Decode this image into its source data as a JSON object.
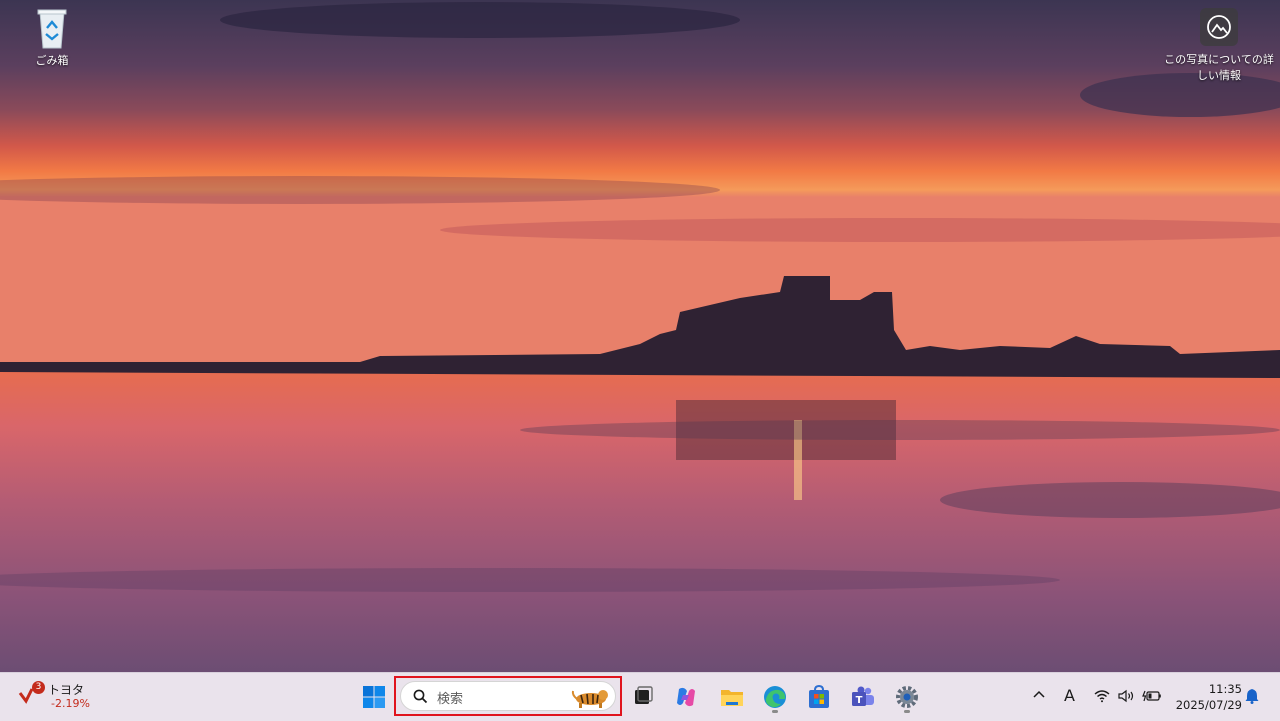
{
  "desktop": {
    "recycle_bin_label": "ごみ箱",
    "spotlight_label_line1": "この写真についての詳",
    "spotlight_label_line2": "しい情報"
  },
  "taskbar": {
    "widget": {
      "badge_count": "3",
      "name": "トヨタ",
      "change": "-2.19%",
      "change_color": "#c42b1c"
    },
    "search": {
      "placeholder": "検索",
      "highlight_color": "#e0141e"
    },
    "apps": [
      "start-icon",
      "task-view-icon",
      "copilot-icon",
      "file-explorer-icon",
      "edge-icon",
      "store-icon",
      "teams-icon",
      "settings-icon"
    ],
    "tray": {
      "ime": "A",
      "time": "11:35",
      "date": "2025/07/29"
    }
  }
}
